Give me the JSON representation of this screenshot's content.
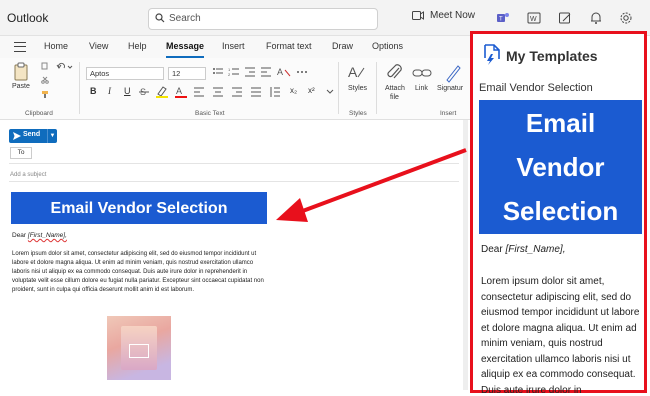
{
  "app": {
    "title": "Outlook"
  },
  "search": {
    "placeholder": "Search"
  },
  "topbar": {
    "meet_now": "Meet Now"
  },
  "menu": {
    "items": [
      "Home",
      "View",
      "Help",
      "Message",
      "Insert",
      "Format text",
      "Draw",
      "Options"
    ],
    "active": "Message"
  },
  "ribbon": {
    "paste": "Paste",
    "clipboard": "Clipboard",
    "font": "Aptos",
    "size": "12",
    "basic_text": "Basic Text",
    "styles": "Styles",
    "styles_group": "Styles",
    "attach": "Attach",
    "attach2": "file",
    "link": "Link",
    "signature": "Signatur",
    "insert_group": "Insert"
  },
  "compose": {
    "send": "Send",
    "to": "To",
    "subject_placeholder": "Add a subject",
    "banner": "Email Vendor Selection",
    "dear": "Dear",
    "first_name": "[First_Name],",
    "body": "Lorem ipsum dolor sit amet, consectetur adipiscing elit, sed do eiusmod tempor incididunt ut labore et dolore magna aliqua. Ut enim ad minim veniam, quis nostrud exercitation ullamco laboris nisi ut aliquip ex ea commodo consequat. Duis aute irure dolor in reprehenderit in voluptate velit esse cillum dolore eu fugiat nulla pariatur. Excepteur sint occaecat cupidatat non proident, sunt in culpa qui officia deserunt mollit anim id est laborum."
  },
  "panel": {
    "title": "My Templates",
    "template_name": "Email Vendor Selection",
    "banner_lines": [
      "Email",
      "Vendor",
      "Selection"
    ],
    "dear": "Dear",
    "first_name": "[First_Name],",
    "body": "Lorem ipsum dolor sit amet, consectetur adipiscing elit, sed do eiusmod tempor incididunt ut labore et dolore magna aliqua. Ut enim ad minim veniam, quis nostrud exercitation ullamco laboris nisi ut aliquip ex ea commodo consequat. Duis aute irure dolor in reprehenderit"
  },
  "colors": {
    "accent": "#0f6cbd",
    "banner": "#1b5bd1",
    "highlight": "#e8101c"
  }
}
